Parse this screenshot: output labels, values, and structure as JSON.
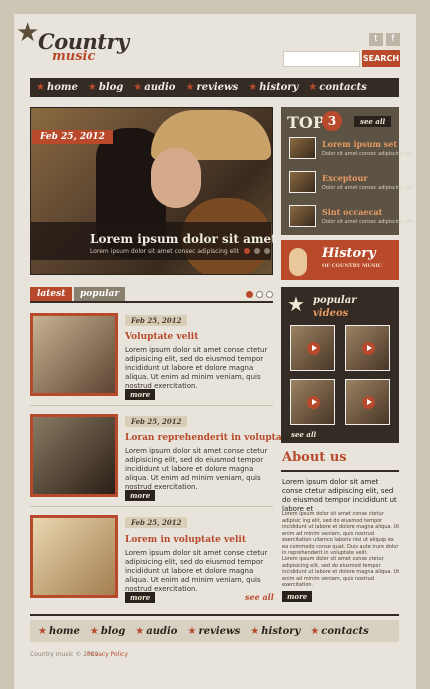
{
  "brand": {
    "logo_top": "Country",
    "logo_bottom": "music"
  },
  "social": [
    "t",
    "f"
  ],
  "search": {
    "placeholder": "",
    "button": "SEARCH"
  },
  "nav": [
    "home",
    "blog",
    "audio",
    "reviews",
    "history",
    "contacts"
  ],
  "slider": {
    "date": "Feb 25, 2012",
    "title": "Lorem ipsum dolor sit amet",
    "text": "Lorem ipsum dolor sit amet consec adipiscing elit"
  },
  "top3": {
    "label": "TOP",
    "number": "3",
    "see_all": "see all",
    "items": [
      {
        "title": "Lorem ipsum set",
        "text": "Dolor sit amet consec adipiscing elit"
      },
      {
        "title": "Exceptour",
        "text": "Dolor sit amet consec adipiscing elit"
      },
      {
        "title": "Sint occaecat",
        "text": "Dolor sit amet consec adipiscing elit"
      }
    ]
  },
  "history": {
    "title": "History",
    "subtitle": "OF COUNTRY MUSIC"
  },
  "tabs": {
    "latest": "latest",
    "popular": "popular"
  },
  "posts": [
    {
      "date": "Feb 25, 2012",
      "title": "Voluptate velit",
      "text": "Lorem ipsum dolor sit amet conse ctetur adipisicing elit, sed do eiusmod tempor incididunt ut labore et dolore magna aliqua. Ut enim ad minim veniam, quis nostrud exercitation.",
      "more": "more"
    },
    {
      "date": "Feb 25, 2012",
      "title": "Loran reprehenderit in voluptate",
      "text": "Lorem ipsum dolor sit amet conse ctetur adipisicing elit, sed do eiusmod tempor incididunt ut labore et dolore magna aliqua. Ut enim ad minim veniam, quis nostrud exercitation.",
      "more": "more"
    },
    {
      "date": "Feb 25, 2012",
      "title": "Lorem in voluptate velit",
      "text": "Lorem ipsum dolor sit amet conse ctetur adipisicing elit, sed do eiusmod tempor incididunt ut labore et dolore magna aliqua. Ut enim ad minim veniam, quis nostrud exercitation.",
      "more": "more"
    }
  ],
  "see_all_posts": "see all",
  "videos": {
    "title1": "popular",
    "title2": "videos",
    "see_all": "see all"
  },
  "about": {
    "title": "About us",
    "lead": "Lorem ipsum dolor sit amet conse ctetur adipiscing elit, sed do eiusmod tempor incididunt ut labore et",
    "p1": "Lorem ipsum dolor sit amet conse ctetur adipisic ing elit, sed do eiusmod tempor incididunt ut labore et dolore magna aliqua. Ut enim ad minim veniam, quis nostrud exercitation ullamco laboris nisi ut aliquip ex ea commodo conse quat. Duis aute irure dolor in reprehenderit in voluptate velit.",
    "p2": "Lorem ipsum dolor sit amet conse ctetur adipisicing elit, sed do eiusmod tempor incididunt ut labore et dolore magna aliqua. Ut enim ad minim veniam, quis nostrud exercitation.",
    "more": "more"
  },
  "footer": {
    "copyright": "Country music © 2013",
    "privacy": "Privacy Policy"
  }
}
